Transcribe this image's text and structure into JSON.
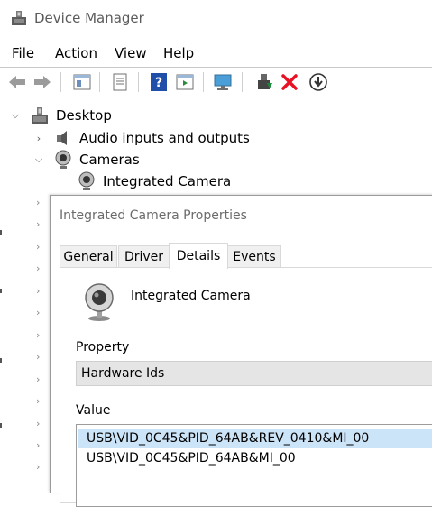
{
  "window": {
    "title": "Device Manager"
  },
  "menu": [
    "File",
    "Action",
    "View",
    "Help"
  ],
  "toolbar": {
    "icons": [
      "back-arrow-icon",
      "forward-arrow-icon",
      "show-hide-tree-icon",
      "properties-icon",
      "help-icon",
      "action-pane-icon",
      "scan-hardware-icon",
      "update-driver-icon",
      "uninstall-icon",
      "disable-device-icon"
    ],
    "colors": {
      "help": "#1f4fa8",
      "remove": "#e81123",
      "update": "#1a8a3a"
    }
  },
  "tree": {
    "root": "Desktop",
    "audio": "Audio inputs and outputs",
    "cameras": "Cameras",
    "camera_child": "Integrated Camera"
  },
  "dialog": {
    "title": "Integrated Camera Properties",
    "tabs": [
      "General",
      "Driver",
      "Details",
      "Events"
    ],
    "active_tab": "Details",
    "device_name": "Integrated Camera",
    "property_label": "Property",
    "property_value": "Hardware Ids",
    "value_label": "Value",
    "values": [
      "USB\\VID_0C45&PID_64AB&REV_0410&MI_00",
      "USB\\VID_0C45&PID_64AB&MI_00"
    ]
  }
}
